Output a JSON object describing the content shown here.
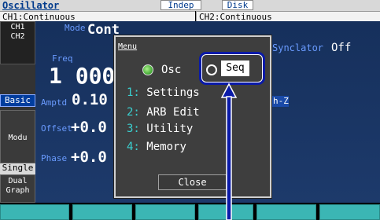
{
  "titlebar": {
    "title": "Oscillator",
    "indep_label": "Indep",
    "disk_label": "Disk"
  },
  "channels": {
    "ch1": "CH1:Continuous",
    "ch2": "CH2:Continuous"
  },
  "sidebar": {
    "ch_line1": "CH1",
    "ch_line2": "CH2",
    "basic": "Basic",
    "modu": "Modu",
    "single": "Single",
    "dual_line1": "Dual",
    "dual_line2": "Graph"
  },
  "params": {
    "mode_label": "Mode",
    "mode_value": "Cont",
    "freq_label": "Freq",
    "freq_value": "1 000.",
    "amptd_label": "Amptd",
    "amptd_value": "0.10",
    "offset_label": "Offset",
    "offset_value": "+0.0",
    "phase_label": "Phase",
    "phase_value": "+0.0",
    "sync_label": "Synclator",
    "sync_value": "Off",
    "hz_tag": "h-Z"
  },
  "menu": {
    "title": "Menu",
    "osc_label": "Osc",
    "seq_label": "Seq",
    "selected": "Osc",
    "items": [
      {
        "num": "1:",
        "label": "Settings"
      },
      {
        "num": "2:",
        "label": "ARB Edit"
      },
      {
        "num": "3:",
        "label": "Utility"
      },
      {
        "num": "4:",
        "label": "Memory"
      }
    ],
    "close_label": "Close"
  },
  "colors": {
    "accent_blue": "#6a9bff",
    "menu_number": "#3ad0d0",
    "softkey": "#3bb6b4",
    "callout": "#0a1aa8"
  }
}
